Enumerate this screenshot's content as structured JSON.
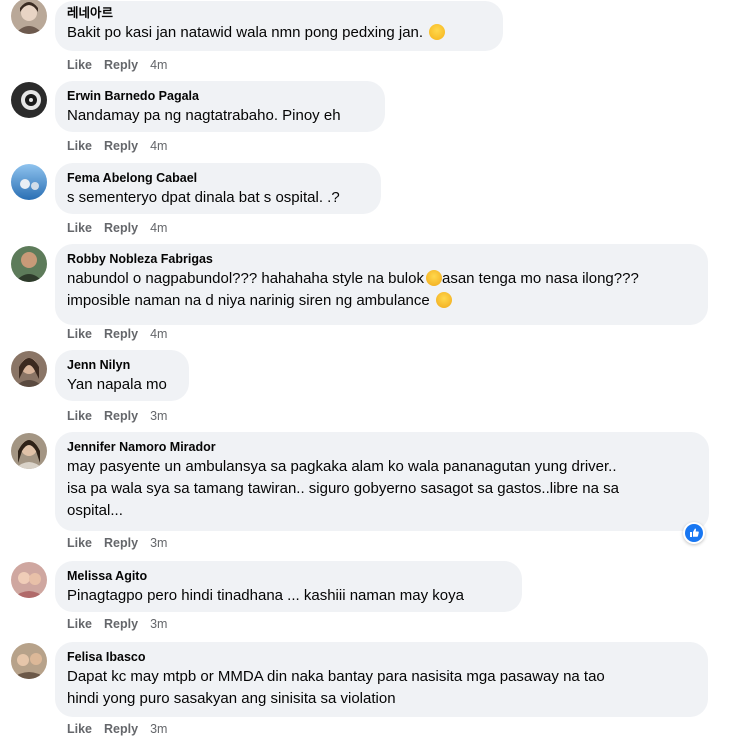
{
  "actions": {
    "like": "Like",
    "reply": "Reply"
  },
  "comments": [
    {
      "author": "레네아르",
      "text": "Bakit po kasi jan natawid wala nmn pong pedxing jan.",
      "time": "4m",
      "emoji": "grinning-sweat"
    },
    {
      "author": "Erwin Barnedo Pagala",
      "text": "Nandamay pa ng nagtatrabaho. Pinoy eh",
      "time": "4m"
    },
    {
      "author": "Fema Abelong Cabael",
      "text": "s sementeryo dpat dinala bat s ospital. .?",
      "time": "4m"
    },
    {
      "author": "Robby Nobleza Fabrigas",
      "text_parts": [
        "nabundol o nagpabundol??? hahahaha style na bulok",
        "asan tenga mo nasa ilong??? imposible naman na d niya narinig siren ng ambulance"
      ],
      "emoji_mid": "rofl",
      "emoji": "joy",
      "time": "4m"
    },
    {
      "author": "Jenn Nilyn",
      "text": "Yan napala mo",
      "time": "3m"
    },
    {
      "author": "Jennifer Namoro Mirador",
      "text": "may pasyente un ambulansya sa pagkaka alam ko wala pananagutan yung driver..\nisa pa wala sya sa tamang tawiran.. siguro gobyerno sasagot sa gastos..libre na sa\nospital...",
      "time": "3m",
      "reaction": "like-icon"
    },
    {
      "author": "Melissa Agito",
      "text": "Pinagtagpo pero hindi tinadhana ... kashiii naman may koya",
      "time": "3m"
    },
    {
      "author": "Felisa Ibasco",
      "text": "Dapat kc may mtpb or MMDA din naka bantay para nasisita mga pasaway na tao\nhindi yong puro sasakyan ang sinisita sa violation",
      "time": "3m"
    }
  ],
  "colors": {
    "bubble": "#f0f2f5",
    "meta": "#65676b",
    "like_blue": "#1877f2"
  }
}
